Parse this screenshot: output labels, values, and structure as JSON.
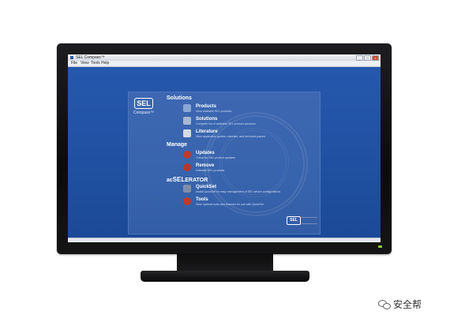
{
  "window": {
    "title": "SEL Compass™",
    "controls": [
      "_",
      "□",
      "×"
    ]
  },
  "menu": [
    "File",
    "View",
    "Tools",
    "Help"
  ],
  "panel": {
    "logo": "SEL",
    "logo_subtitle": "Compass™",
    "sections": {
      "solutions": "Solutions",
      "manage": "Manage",
      "accel_prefix": "ac",
      "accel_main": "SEL",
      "accel_suffix": "ERATOR"
    },
    "items": [
      {
        "name": "Products",
        "desc": "View available SEL products",
        "icon": "products-icon",
        "color": "#8aa7d6"
      },
      {
        "name": "Solutions",
        "desc": "Complete list of available SEL product solutions",
        "icon": "solutions-icon",
        "color": "#a7b8d4"
      },
      {
        "name": "Literature",
        "desc": "View application guides, manuals, and technical papers",
        "icon": "literature-icon",
        "color": "#d5dbe6"
      },
      {
        "name": "Updates",
        "desc": "Check for SEL product updates",
        "icon": "updates-icon",
        "color": "#c0392b"
      },
      {
        "name": "Remove",
        "desc": "Uninstall SEL products",
        "icon": "remove-icon",
        "color": "#b03a2e"
      },
      {
        "name": "QuickSet",
        "desc": "Install QuickSet for easy management of SEL device configurations",
        "icon": "quickset-icon",
        "color": "#7f8ea8"
      },
      {
        "name": "Tools",
        "desc": "View optional tools and features for use with QuickSet",
        "icon": "tools-icon",
        "color": "#c0392b"
      }
    ],
    "footer_logo": "SEL"
  },
  "watermark_badge": {
    "label": "安全帮"
  }
}
